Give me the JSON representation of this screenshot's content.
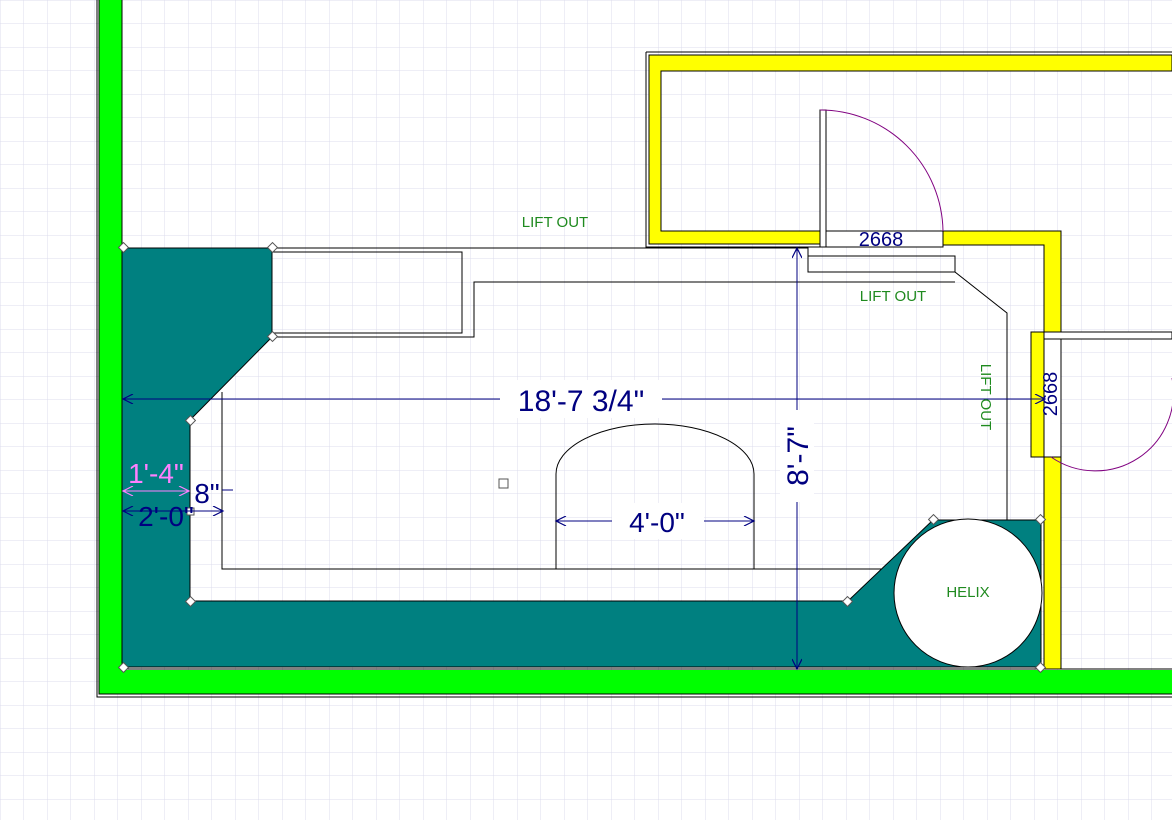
{
  "plan": {
    "labels": {
      "lift_out_top": "LIFT OUT",
      "lift_out_mid": "LIFT OUT",
      "lift_out_vertical": "LIFT OUT",
      "door_top": "2668",
      "door_right": "2668",
      "helix": "HELIX"
    },
    "dimensions": {
      "overall_width": "18'-7 3/4\"",
      "overall_depth": "8'-7\"",
      "peninsula_width": "4'-0\"",
      "pink_dim": "1'-4\"",
      "left_dim": "2'-0\"",
      "small_dim": "8\""
    }
  },
  "colors": {
    "grid": "#dcdcec",
    "benchwork": "#008080",
    "exterior_wall": "#00ff00",
    "interior_wall": "#ffff00",
    "dimension": "#000080",
    "label_green": "#1f8a1f",
    "door_swing": "#800080",
    "pink_dimension": "#ff80ff"
  }
}
